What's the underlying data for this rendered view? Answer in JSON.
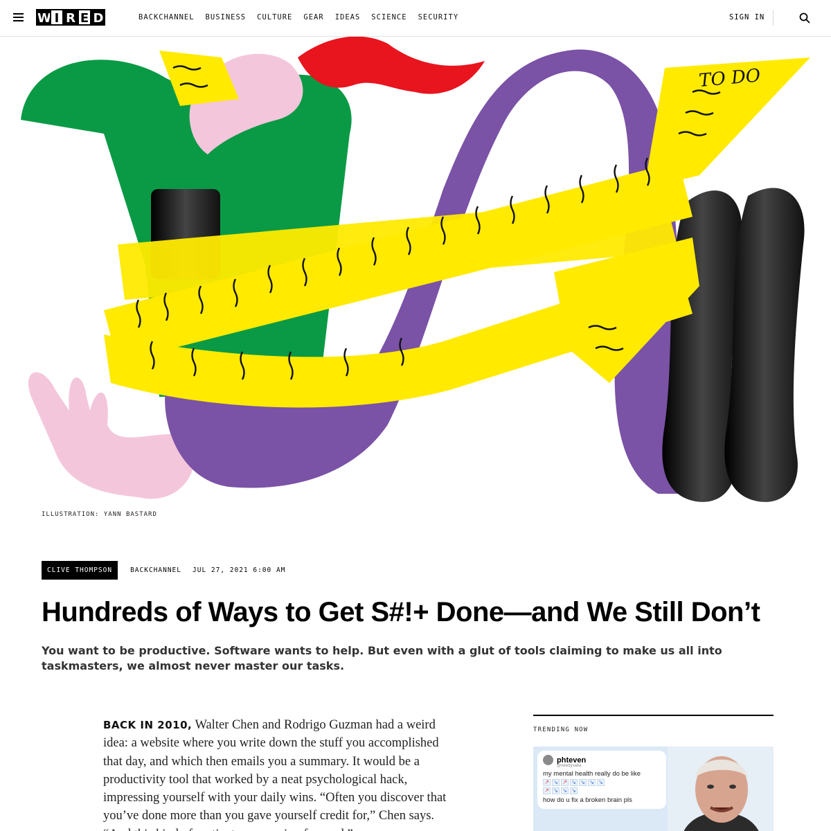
{
  "header": {
    "logo_letters": [
      "W",
      "I",
      "R",
      "E",
      "D"
    ],
    "nav": [
      "BACKCHANNEL",
      "BUSINESS",
      "CULTURE",
      "GEAR",
      "IDEAS",
      "SCIENCE",
      "SECURITY"
    ],
    "sign_in": "SIGN IN",
    "icons": {
      "menu": "hamburger-icon",
      "search": "search-icon"
    }
  },
  "hero": {
    "todo_text": "TO DO",
    "caption": "ILLUSTRATION: YANN BASTARD",
    "colors": {
      "green": "#0a9a45",
      "purple": "#7a52a6",
      "yellow": "#ffea00",
      "pink": "#f4c6dc",
      "red": "#e8141e",
      "black": "#111111"
    }
  },
  "article": {
    "author": "CLIVE THOMPSON",
    "category": "BACKCHANNEL",
    "date": "JUL 27, 2021 6:00 AM",
    "headline": "Hundreds of Ways to Get S#!+ Done—and We Still Don’t",
    "dek": "You want to be productive. Software wants to help. But even with a glut of tools claiming to make us all into taskmasters, we almost never master our tasks.",
    "lead_in": "BACK IN 2010,",
    "body": " Walter Chen and Rodrigo Guzman had a weird idea: a website where you write down the stuff you accomplished that day, and which then emails you a summary. It would be a productivity tool that worked by a neat psychological hack, impressing yourself with your daily wins. “Often you discover that you’ve done more than you gave yourself credit for,” Chen says. “And this kind of motivates you going forward.”"
  },
  "trending": {
    "label": "TRENDING NOW",
    "tweet": {
      "name": "phteven",
      "handle": "@needysaba",
      "line1": "my mental health really do be like",
      "line2": "how do u fix a broken brain pls"
    }
  }
}
